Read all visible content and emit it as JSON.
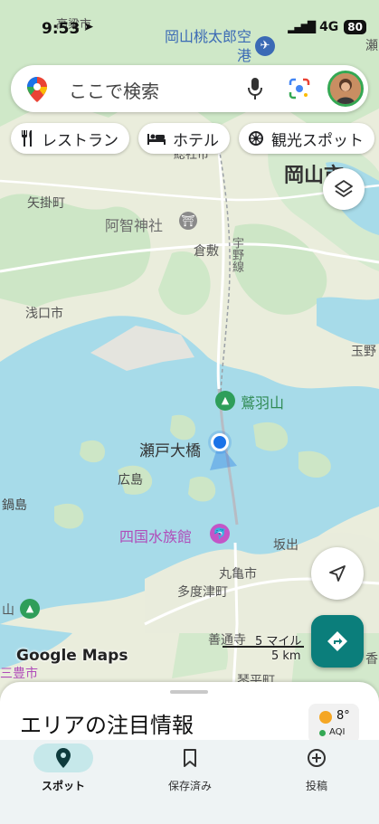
{
  "status": {
    "time": "9:53",
    "network": "4G",
    "battery": "80"
  },
  "search": {
    "placeholder": "ここで検索"
  },
  "chips": [
    {
      "label": "レストラン",
      "icon": "fork-knife-icon"
    },
    {
      "label": "ホテル",
      "icon": "bed-icon"
    },
    {
      "label": "観光スポット",
      "icon": "attraction-icon"
    }
  ],
  "map": {
    "labels": {
      "airport": "岡山桃太郎空港",
      "okayama": "岡山市",
      "takahashi": "高梁市",
      "yakage": "矢掛町",
      "achi": "阿智神社",
      "kurashiki": "倉敷",
      "uno_line": "宇野線",
      "asakuchi": "浅口市",
      "tamano": "玉野",
      "washuzan": "鷲羽山",
      "seto_ohashi": "瀬戸大橋",
      "hiroshima": "広島",
      "nabeshima": "鍋島",
      "aquarium": "四国水族館",
      "sakaide": "坂出",
      "marugame": "丸亀市",
      "tadotsu": "多度津町",
      "zentsuji": "善通寺",
      "kotohira": "琴平町",
      "mitoyo": "三豊市",
      "soja": "総社市",
      "kotohira_edge": "香",
      "yama": "山",
      "setoshi": "瀬"
    }
  },
  "logo": "Google Maps",
  "scale": {
    "miles": "5 マイル",
    "km": "5 km"
  },
  "sheet": {
    "title": "エリアの注目情報"
  },
  "weather": {
    "temp": "8°",
    "aqi_label": "AQI"
  },
  "nav": [
    {
      "label": "スポット",
      "icon": "location-pin-icon",
      "active": true
    },
    {
      "label": "保存済み",
      "icon": "bookmark-icon",
      "active": false
    },
    {
      "label": "投稿",
      "icon": "add-circle-icon",
      "active": false
    }
  ],
  "colors": {
    "water": "#a7dbe9",
    "land": "#e9ecdc",
    "green": "#c7e4c2",
    "accent": "#0b7e7b",
    "location": "#1a73e8"
  }
}
